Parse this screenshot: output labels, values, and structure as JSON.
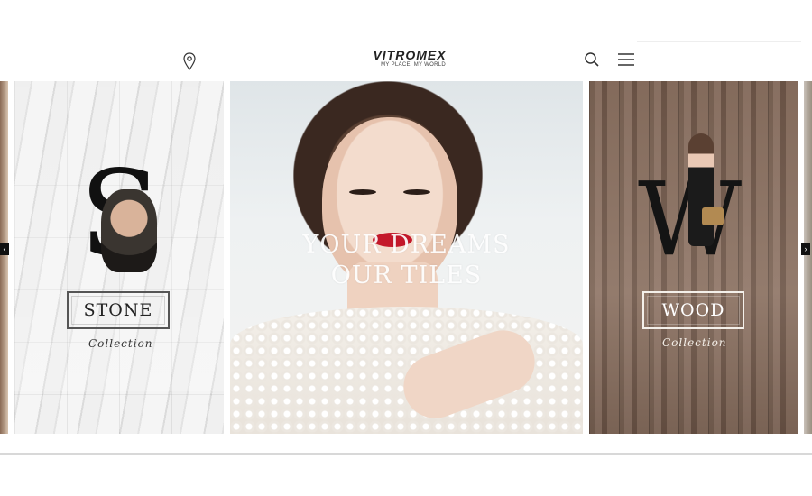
{
  "header": {
    "logo_name": "VITROMEX",
    "logo_tagline": "MY PLACE, MY WORLD",
    "icons": [
      "location-pin-icon",
      "search-icon",
      "hamburger-menu-icon"
    ]
  },
  "carousel": {
    "slides": [
      {
        "letter": "S",
        "label": "STONE",
        "sub": "Collection"
      },
      {
        "headline_line1": "YOUR DREAMS",
        "headline_line2": "OUR TILES"
      },
      {
        "letter": "W",
        "label": "WOOD",
        "sub": "Collection"
      }
    ],
    "prev_glyph": "‹",
    "next_glyph": "›"
  },
  "colors": {
    "lip_red": "#c4182a",
    "arrow_bg": "#111111",
    "text_dark": "#222222"
  }
}
